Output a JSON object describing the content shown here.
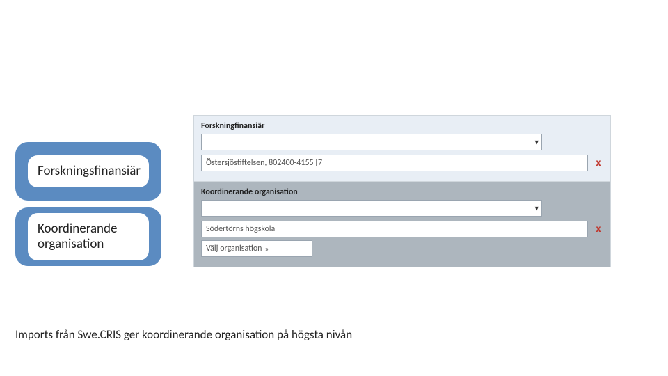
{
  "callouts": {
    "funder": "Forskningsfinansiär",
    "coord": "Koordinerande organisation"
  },
  "form": {
    "funder_section": {
      "label": "Forskningfinansiär",
      "select_placeholder": "",
      "entry_value": "Östersjöstiftelsen, 802400-4155 [7]",
      "delete_label": "x"
    },
    "coord_section": {
      "label": "Koordinerande organisation",
      "select_placeholder": "",
      "entry_value": "Södertörns högskola",
      "delete_label": "x",
      "picker_label": "Välj organisation",
      "picker_arrow": "»"
    }
  },
  "footer": "Imports från Swe.CRIS ger koordinerande organisation på högsta nivån"
}
